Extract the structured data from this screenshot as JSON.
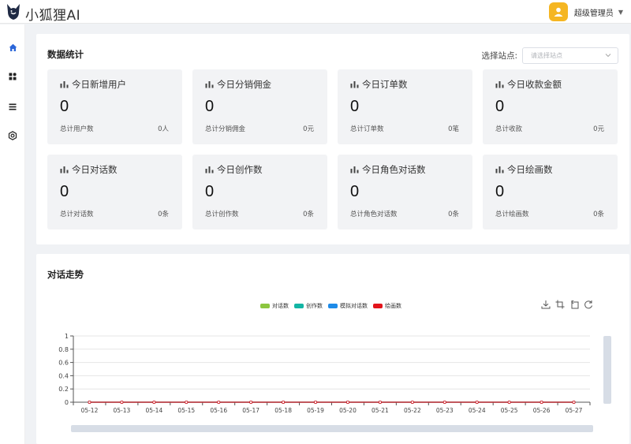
{
  "brand": {
    "name": "小狐狸AI",
    "accent": "#2b66d9"
  },
  "user": {
    "name": "超级管理员",
    "avatar_color": "#f5b622"
  },
  "sidebar": {
    "items": [
      {
        "icon": "home-icon",
        "active": true
      },
      {
        "icon": "apps-grid-icon"
      },
      {
        "icon": "list-menu-icon"
      },
      {
        "icon": "settings-gear-icon"
      }
    ]
  },
  "stats": {
    "title": "数据统计",
    "site_label": "选择站点:",
    "site_placeholder": "请选择站点",
    "cards": [
      {
        "title": "今日新增用户",
        "value": "0",
        "sub": "总计用户数",
        "total": "0人"
      },
      {
        "title": "今日分销佣金",
        "value": "0",
        "sub": "总计分销佣金",
        "total": "0元"
      },
      {
        "title": "今日订单数",
        "value": "0",
        "sub": "总计订单数",
        "total": "0笔"
      },
      {
        "title": "今日收款金额",
        "value": "0",
        "sub": "总计收款",
        "total": "0元"
      },
      {
        "title": "今日对话数",
        "value": "0",
        "sub": "总计对话数",
        "total": "0条"
      },
      {
        "title": "今日创作数",
        "value": "0",
        "sub": "总计创作数",
        "total": "0条"
      },
      {
        "title": "今日角色对话数",
        "value": "0",
        "sub": "总计角色对话数",
        "total": "0条"
      },
      {
        "title": "今日绘画数",
        "value": "0",
        "sub": "总计绘画数",
        "total": "0条"
      }
    ]
  },
  "trend": {
    "title": "对话走势",
    "toolbox": [
      "download-icon",
      "zoom-select-icon",
      "zoom-reset-icon",
      "restore-icon"
    ]
  },
  "chart_data": {
    "type": "line",
    "categories": [
      "05-12",
      "05-13",
      "05-14",
      "05-15",
      "05-16",
      "05-17",
      "05-18",
      "05-19",
      "05-20",
      "05-21",
      "05-22",
      "05-23",
      "05-24",
      "05-25",
      "05-26",
      "05-27"
    ],
    "series": [
      {
        "name": "对话数",
        "color": "#8cc63f",
        "values": [
          0,
          0,
          0,
          0,
          0,
          0,
          0,
          0,
          0,
          0,
          0,
          0,
          0,
          0,
          0,
          0
        ]
      },
      {
        "name": "创作数",
        "color": "#13b5a4",
        "values": [
          0,
          0,
          0,
          0,
          0,
          0,
          0,
          0,
          0,
          0,
          0,
          0,
          0,
          0,
          0,
          0
        ]
      },
      {
        "name": "模拟对话数",
        "color": "#1e8be8",
        "values": [
          0,
          0,
          0,
          0,
          0,
          0,
          0,
          0,
          0,
          0,
          0,
          0,
          0,
          0,
          0,
          0
        ]
      },
      {
        "name": "绘画数",
        "color": "#e3141b",
        "values": [
          0,
          0,
          0,
          0,
          0,
          0,
          0,
          0,
          0,
          0,
          0,
          0,
          0,
          0,
          0,
          0
        ]
      }
    ],
    "ylim": [
      0,
      1
    ],
    "yticks": [
      "0",
      "0.2",
      "0.4",
      "0.6",
      "0.8",
      "1"
    ],
    "grid": true,
    "legend_position": "top-center"
  }
}
